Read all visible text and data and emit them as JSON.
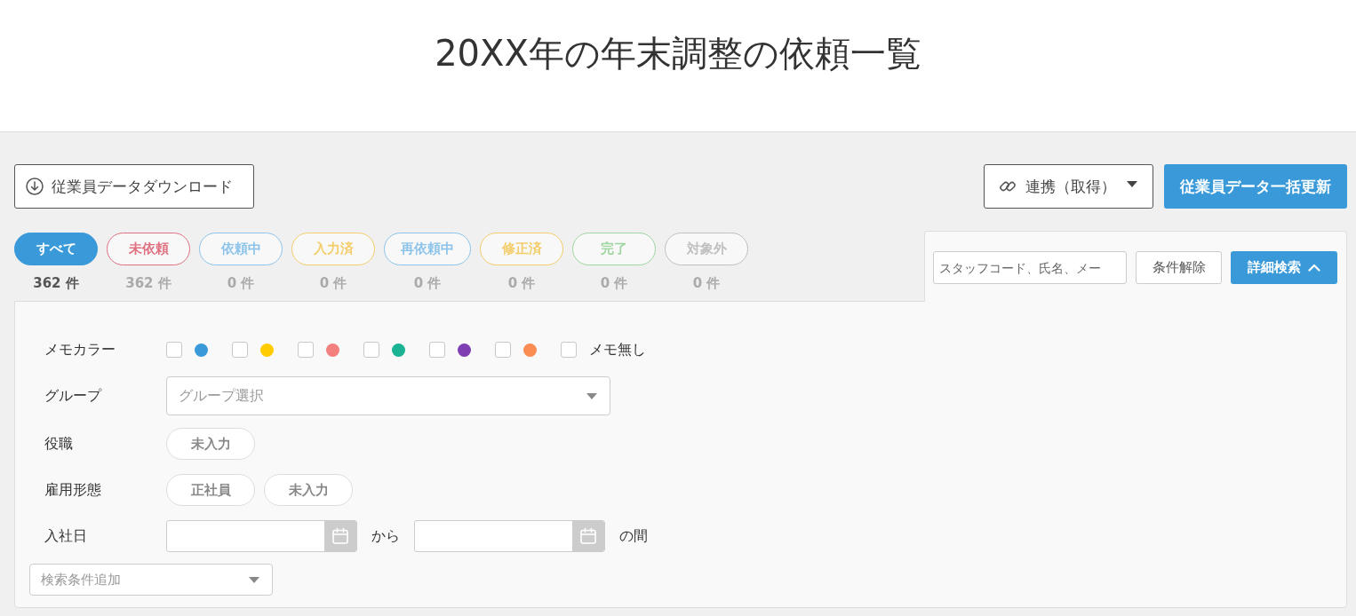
{
  "header": {
    "title": "20XX年の年末調整の依頼一覧"
  },
  "toolbar": {
    "download_button": "従業員データダウンロード",
    "sync_button": "連携（取得）",
    "bulk_update_button": "従業員データ一括更新"
  },
  "status_tabs": [
    {
      "label": "すべて",
      "count": "362 件",
      "color": "#3a9ad9",
      "selected": true
    },
    {
      "label": "未依頼",
      "count": "362 件",
      "color": "#e07080",
      "selected": false
    },
    {
      "label": "依頼中",
      "count": "0 件",
      "color": "#8cc3ea",
      "selected": false
    },
    {
      "label": "入力済",
      "count": "0 件",
      "color": "#f3cd6a",
      "selected": false
    },
    {
      "label": "再依頼中",
      "count": "0 件",
      "color": "#8cc3ea",
      "selected": false
    },
    {
      "label": "修正済",
      "count": "0 件",
      "color": "#f3cd6a",
      "selected": false
    },
    {
      "label": "完了",
      "count": "0 件",
      "color": "#9fd6a0",
      "selected": false
    },
    {
      "label": "対象外",
      "count": "0 件",
      "color": "#c0c0c0",
      "selected": false
    }
  ],
  "search": {
    "placeholder": "スタッフコード、氏名、メー",
    "clear_button": "条件解除",
    "advanced_button": "詳細検索",
    "expanded": true
  },
  "filters": {
    "memo_color": {
      "label": "メモカラー",
      "options": [
        {
          "kind": "color",
          "color": "#3a9ad9",
          "checked": false
        },
        {
          "kind": "color",
          "color": "#ffcc00",
          "checked": false
        },
        {
          "kind": "color",
          "color": "#f47f7f",
          "checked": false
        },
        {
          "kind": "color",
          "color": "#1ab394",
          "checked": false
        },
        {
          "kind": "color",
          "color": "#7e3fb3",
          "checked": false
        },
        {
          "kind": "color",
          "color": "#fb8c52",
          "checked": false
        },
        {
          "kind": "none",
          "label": "メモ無し",
          "checked": false
        }
      ]
    },
    "group": {
      "label": "グループ",
      "placeholder": "グループ選択"
    },
    "position": {
      "label": "役職",
      "options": [
        {
          "label": "未入力",
          "selected": false
        }
      ]
    },
    "employment_type": {
      "label": "雇用形態",
      "options": [
        {
          "label": "正社員",
          "selected": false
        },
        {
          "label": "未入力",
          "selected": false
        }
      ]
    },
    "hire_date": {
      "label": "入社日",
      "from_text": "から",
      "to_text": "の間"
    },
    "add_condition": {
      "placeholder": "検索条件追加"
    }
  }
}
